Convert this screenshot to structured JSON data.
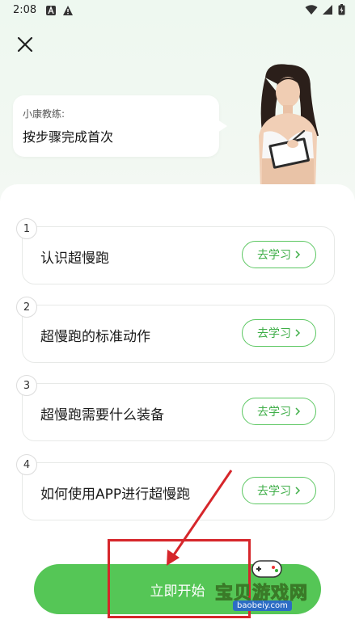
{
  "status_bar": {
    "time": "2:08"
  },
  "coach": {
    "name": "小康教练:",
    "message": "按步骤完成首次"
  },
  "steps": [
    {
      "number": "1",
      "title": "认识超慢跑",
      "button_label": "去学习"
    },
    {
      "number": "2",
      "title": "超慢跑的标准动作",
      "button_label": "去学习"
    },
    {
      "number": "3",
      "title": "超慢跑需要什么装备",
      "button_label": "去学习"
    },
    {
      "number": "4",
      "title": "如何使用APP进行超慢跑",
      "button_label": "去学习"
    }
  ],
  "start_button": {
    "label": "立即开始"
  },
  "watermark": {
    "text": "宝贝游戏网",
    "url": "baobeiy.com"
  },
  "colors": {
    "accent": "#55c656",
    "button_border": "#5bc761",
    "annotation": "#d6262b"
  }
}
